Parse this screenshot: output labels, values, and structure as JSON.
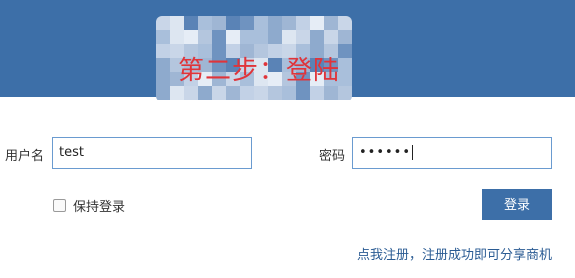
{
  "header": {
    "step_title": "第二步：登陆",
    "bg_color": "#3d6fa8",
    "title_color": "#e0343a"
  },
  "form": {
    "username_label": "用户名",
    "username_value": "test",
    "password_label": "密码",
    "password_masked": "••••••",
    "remember_label": "保持登录",
    "remember_checked": false,
    "login_button": "登录",
    "register_link": "点我注册，注册成功即可分享商机"
  }
}
